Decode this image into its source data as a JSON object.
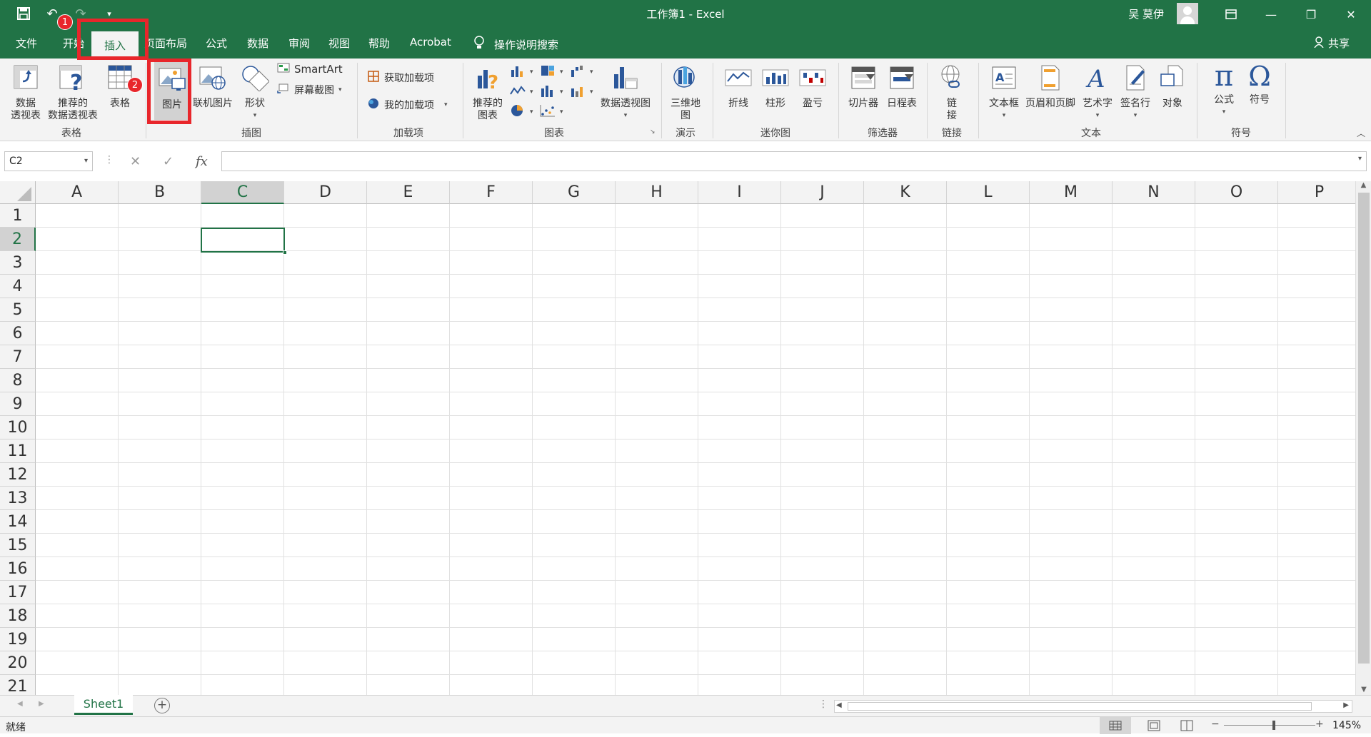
{
  "window": {
    "title": "工作簿1  -  Excel",
    "user_name": "吴 莫伊"
  },
  "tabs": {
    "file": "文件",
    "home": "开始",
    "insert": "插入",
    "page_layout": "页面布局",
    "formulas": "公式",
    "data": "数据",
    "review": "审阅",
    "view": "视图",
    "help": "帮助",
    "acrobat": "Acrobat",
    "tell_me": "操作说明搜索",
    "share": "共享"
  },
  "ribbon": {
    "tables": {
      "pivot": "数据\n透视表",
      "pivot_l1": "数据",
      "pivot_l2": "透视表",
      "rec_pivot_l1": "推荐的",
      "rec_pivot_l2": "数据透视表",
      "table": "表格",
      "group": "表格"
    },
    "illustrations": {
      "pictures": "图片",
      "online_pictures": "联机图片",
      "shapes": "形状",
      "smartart": "SmartArt",
      "screenshot": "屏幕截图",
      "group": "插图"
    },
    "addins": {
      "get": "获取加载项",
      "my": "我的加载项",
      "group": "加载项"
    },
    "charts": {
      "recommended_l1": "推荐的",
      "recommended_l2": "图表",
      "pivot_chart": "数据透视图",
      "group": "图表"
    },
    "tours": {
      "map3d_l1": "三维地",
      "map3d_l2": "图",
      "group": "演示"
    },
    "sparklines": {
      "line": "折线",
      "column": "柱形",
      "winloss": "盈亏",
      "group": "迷你图"
    },
    "filters": {
      "slicer": "切片器",
      "timeline": "日程表",
      "group": "筛选器"
    },
    "links": {
      "link_l1": "链",
      "link_l2": "接",
      "group": "链接"
    },
    "text": {
      "textbox": "文本框",
      "header_footer": "页眉和页脚",
      "wordart": "艺术字",
      "signature": "签名行",
      "object": "对象",
      "group": "文本"
    },
    "symbols": {
      "equation": "公式",
      "symbol": "符号",
      "group": "符号"
    }
  },
  "annotations": {
    "step1": "1",
    "step2": "2"
  },
  "formula_bar": {
    "name_box": "C2",
    "fx": "fx",
    "value": ""
  },
  "grid": {
    "columns": [
      "A",
      "B",
      "C",
      "D",
      "E",
      "F",
      "G",
      "H",
      "I",
      "J",
      "K",
      "L",
      "M",
      "N",
      "O",
      "P"
    ],
    "rows": [
      "1",
      "2",
      "3",
      "4",
      "5",
      "6",
      "7",
      "8",
      "9",
      "10",
      "11",
      "12",
      "13",
      "14",
      "15",
      "16",
      "17",
      "18",
      "19",
      "20",
      "21"
    ],
    "selected_cell": "C2"
  },
  "sheets": {
    "active": "Sheet1"
  },
  "status": {
    "mode": "就绪",
    "zoom": "145%"
  },
  "colors": {
    "accent": "#217346",
    "annotation": "#e8262b"
  }
}
